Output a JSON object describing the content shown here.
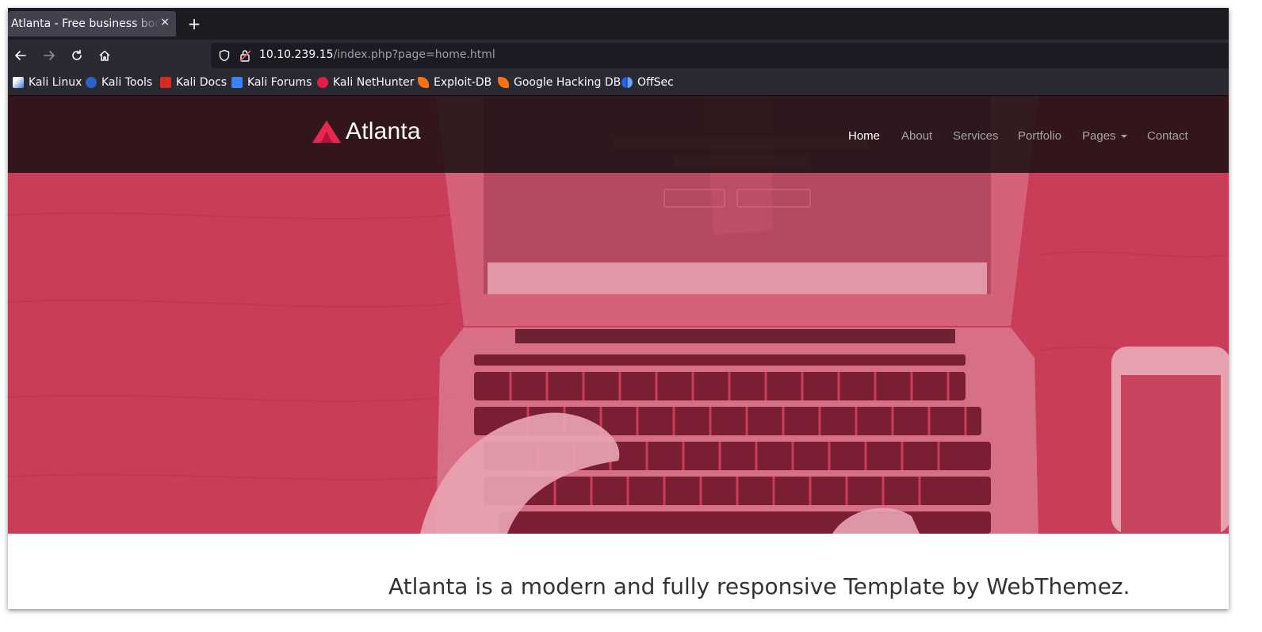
{
  "browser": {
    "tab": {
      "title": "Atlanta - Free business bootstrap template",
      "close_glyph": "×"
    },
    "new_tab_glyph": "+",
    "nav": {
      "back_icon": "arrow-left-icon",
      "forward_icon": "arrow-right-icon",
      "reload_icon": "reload-icon",
      "home_icon": "home-icon"
    },
    "url": {
      "host": "10.10.239.15",
      "path": "/index.php?page=home.html"
    },
    "bookmarks": [
      {
        "label": "Kali Linux",
        "color": "#3a7bd5"
      },
      {
        "label": "Kali Tools",
        "color": "#2a63c9"
      },
      {
        "label": "Kali Docs",
        "color": "#d52b1e"
      },
      {
        "label": "Kali Forums",
        "color": "#3b82f6"
      },
      {
        "label": "Kali NetHunter",
        "color": "#e11d48"
      },
      {
        "label": "Exploit-DB",
        "color": "#f97316"
      },
      {
        "label": "Google Hacking DB",
        "color": "#f97316"
      },
      {
        "label": "OffSec",
        "color": "#2563eb"
      }
    ]
  },
  "site": {
    "brand": "Atlanta",
    "nav": [
      {
        "label": "Home",
        "active": true
      },
      {
        "label": "About"
      },
      {
        "label": "Services"
      },
      {
        "label": "Portfolio"
      },
      {
        "label": "Pages"
      },
      {
        "label": "Contact"
      }
    ],
    "hero_overlay_color": "#c93d59",
    "tagline": "Atlanta is a modern and fully responsive Template by WebThemez."
  }
}
